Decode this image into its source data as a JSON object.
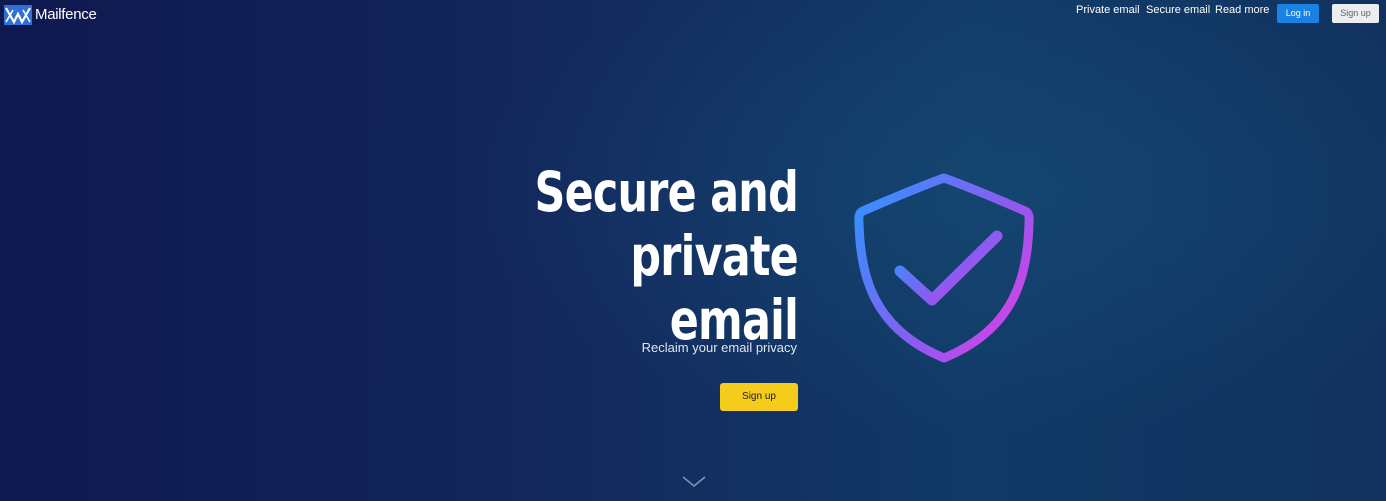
{
  "header": {
    "brand_name": "Mailfence",
    "nav": [
      {
        "label": "Private email"
      },
      {
        "label": "Secure email"
      },
      {
        "label": "Read more"
      }
    ],
    "login_label": "Log in",
    "signup_label": "Sign up"
  },
  "hero": {
    "title_line1": "Secure and private",
    "title_line2": "email",
    "subtitle": "Reclaim your email privacy",
    "cta_label": "Sign up"
  },
  "icons": {
    "brand_logo": "mailfence-logo",
    "hero_illustration": "shield-check-icon",
    "scroll": "chevron-down-icon"
  },
  "colors": {
    "background_start": "#0f1850",
    "background_end": "#12325f",
    "login_button": "#1a82e6",
    "signup_button_top": "#ebedf0",
    "cta_button": "#f6cc1c",
    "shield_gradient_start": "#3a8dff",
    "shield_gradient_end": "#e43ce8"
  }
}
